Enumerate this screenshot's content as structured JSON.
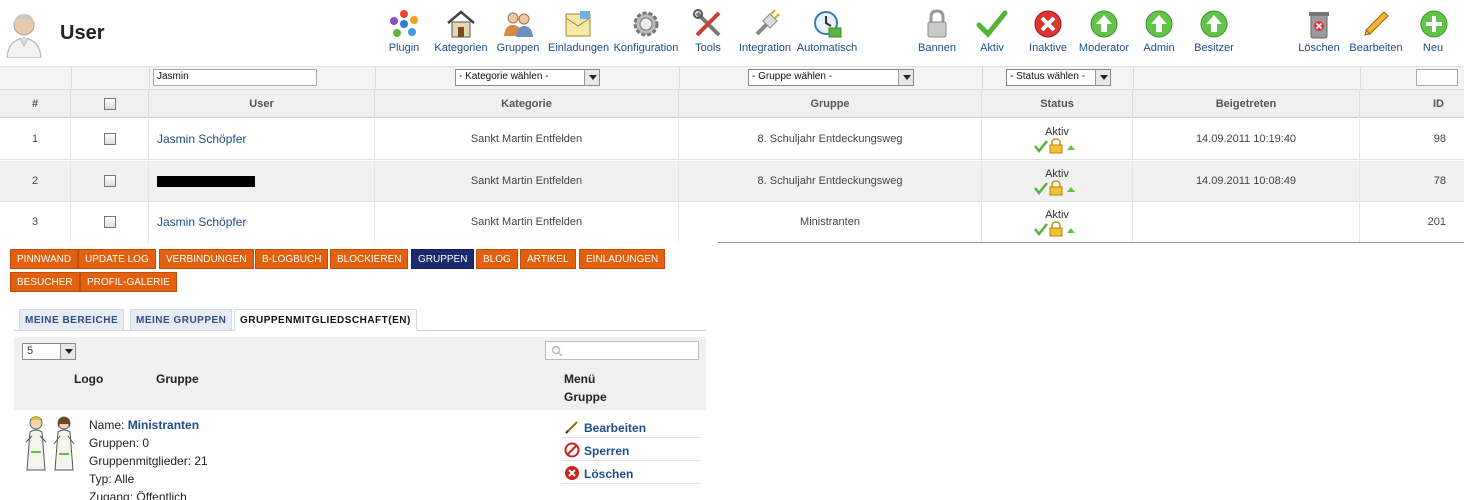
{
  "header": {
    "title": "User"
  },
  "toolbar": {
    "buttons": [
      {
        "label": "Plugin",
        "icon": "plugin-icon"
      },
      {
        "label": "Kategorien",
        "icon": "house-icon"
      },
      {
        "label": "Gruppen",
        "icon": "users-icon"
      },
      {
        "label": "Einladungen",
        "icon": "invitation-icon"
      },
      {
        "label": "Konfiguration",
        "icon": "gear-icon"
      },
      {
        "label": "Tools",
        "icon": "tools-icon"
      },
      {
        "label": "Integration",
        "icon": "plug-icon"
      },
      {
        "label": "Automatisch",
        "icon": "clock-icon"
      },
      {
        "label": "Bannen",
        "icon": "lock-icon"
      },
      {
        "label": "Aktiv",
        "icon": "checkmark-icon"
      },
      {
        "label": "Inaktive",
        "icon": "close-icon"
      },
      {
        "label": "Moderator",
        "icon": "arrow-up-icon"
      },
      {
        "label": "Admin",
        "icon": "arrow-up-icon"
      },
      {
        "label": "Besitzer",
        "icon": "arrow-up-icon"
      },
      {
        "label": "Löschen",
        "icon": "trash-icon"
      },
      {
        "label": "Bearbeiten",
        "icon": "pencil-icon"
      },
      {
        "label": "Neu",
        "icon": "plus-icon"
      }
    ]
  },
  "filters": {
    "search_value": "Jasmin",
    "kategorie": "- Kategorie wählen -",
    "gruppe": "- Gruppe wählen -",
    "status": "- Status wählen -",
    "id_value": ""
  },
  "table": {
    "headers": {
      "num": "#",
      "user": "User",
      "kategorie": "Kategorie",
      "gruppe": "Gruppe",
      "status": "Status",
      "beigetreten": "Beigetreten",
      "id": "ID"
    },
    "rows": [
      {
        "num": "1",
        "user": "Jasmin Schöpfer",
        "kategorie": "Sankt Martin Entfelden",
        "gruppe": "8. Schuljahr Entdeckungsweg",
        "status": "Aktiv",
        "beigetreten": "14.09.2011 10:19:40",
        "id": "98"
      },
      {
        "num": "2",
        "user": "",
        "kategorie": "Sankt Martin Entfelden",
        "gruppe": "8. Schuljahr Entdeckungsweg",
        "status": "Aktiv",
        "beigetreten": "14.09.2011 10:08:49",
        "id": "78"
      },
      {
        "num": "3",
        "user": "Jasmin Schöpfer",
        "kategorie": "Sankt Martin Entfelden",
        "gruppe": "Ministranten",
        "status": "Aktiv",
        "beigetreten": "",
        "id": "201"
      }
    ]
  },
  "profile_tabs": {
    "row1": [
      "PINNWAND",
      "UPDATE LOG",
      "VERBINDUNGEN",
      "B-LOGBUCH",
      "BLOCKIEREN",
      "GRUPPEN",
      "BLOG",
      "ARTIKEL",
      "EINLADUNGEN"
    ],
    "row2": [
      "BESUCHER",
      "PROFIL-GALERIE"
    ],
    "active": "GRUPPEN"
  },
  "sub_tabs": [
    "MEINE BEREICHE",
    "MEINE GRUPPEN",
    "GRUPPENMITGLIEDSCHAFT(EN)"
  ],
  "group_panel": {
    "per_page": "5",
    "col_logo": "Logo",
    "col_gruppe": "Gruppe",
    "col_menu_1": "Menü",
    "col_menu_2": "Gruppe",
    "entry": {
      "name_label": "Name:",
      "name_value": "Ministranten",
      "gruppen": "Gruppen: 0",
      "mitglieder": "Gruppenmitglieder: 21",
      "typ": "Typ: Alle",
      "zugang": "Zugang: Öffentlich"
    },
    "actions": [
      "Bearbeiten",
      "Sperren",
      "Löschen"
    ]
  },
  "colors": {
    "tab_orange": "#e2600e",
    "tab_active": "#1b2a6e",
    "link_blue": "#1f4d8a",
    "ok_green": "#56b33a"
  }
}
